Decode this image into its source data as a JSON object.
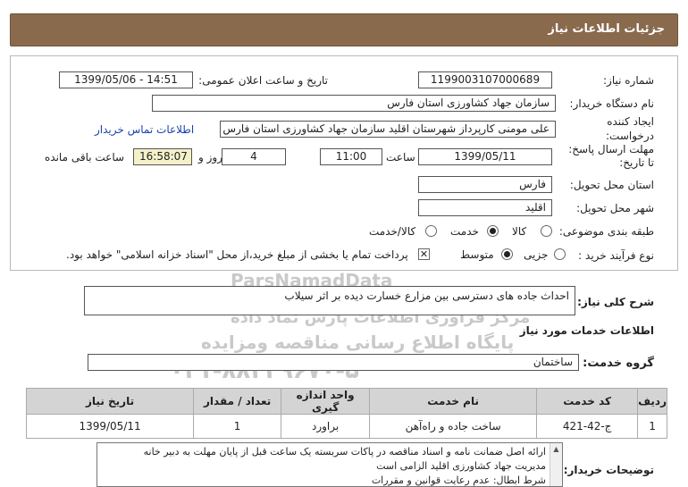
{
  "header": {
    "title": "جزئیات اطلاعات نیاز"
  },
  "form": {
    "need_number_label": "شماره نیاز:",
    "need_number": "1199003107000689",
    "announce_label": "تاریخ و ساعت اعلان عمومی:",
    "announce_value": "1399/05/06 - 14:51",
    "buyer_label": "نام دستگاه خریدار:",
    "buyer_value": "سازمان جهاد کشاورزی استان فارس",
    "creator_label_1": "ایجاد کننده",
    "creator_label_2": "درخواست:",
    "creator_value": "علی  مومنی  کارپرداز شهرستان اقلید  سازمان جهاد کشاورزی استان فارس",
    "contact_link": "اطلاعات تماس خریدار",
    "deadline_label_1": "مهلت ارسال پاسخ:",
    "deadline_label_2": "تا تاریخ:",
    "deadline_date": "1399/05/11",
    "time_label": "ساعت",
    "deadline_time": "11:00",
    "days_value": "4",
    "days_label": "روز و",
    "remaining_time": "16:58:07",
    "remaining_label": "ساعت باقی مانده",
    "province_label": "استان محل تحویل:",
    "province_value": "فارس",
    "city_label": "شهر محل تحویل:",
    "city_value": "اقلید",
    "category_label": "طبقه بندی موضوعی:",
    "category_options": [
      {
        "label": "کالا",
        "selected": false
      },
      {
        "label": "خدمت",
        "selected": true
      },
      {
        "label": "کالا/خدمت",
        "selected": false
      }
    ],
    "process_label": "نوع فرآیند خرید :",
    "process_options": [
      {
        "label": "جزیی",
        "selected": false
      },
      {
        "label": "متوسط",
        "selected": true
      }
    ],
    "payment_checked": true,
    "payment_text": "پرداخت تمام یا بخشی از مبلغ خرید،از محل \"اسناد خزانه اسلامی\" خواهد بود."
  },
  "summary": {
    "label": "شرح کلی نیاز:",
    "value": "احداث جاده های دسترسی بین مزارع خسارت دیده بر اثر سیلاب"
  },
  "services_title": "اطلاعات خدمات مورد نیاز",
  "service_group": {
    "label": "گروه خدمت:",
    "value": "ساختمان"
  },
  "table": {
    "headers": [
      "ردیف",
      "کد خدمت",
      "نام خدمت",
      "واحد اندازه گیری",
      "تعداد / مقدار",
      "تاریخ نیاز"
    ],
    "rows": [
      [
        "1",
        "ج-42-421",
        "ساخت جاده و راه‌آهن",
        "براورد",
        "1",
        "1399/05/11"
      ]
    ]
  },
  "buyer_notes": {
    "label": "توضیحات خریدار:",
    "lines": [
      "ارائه اصل ضمانت نامه و اسناد مناقصه  در پاکات سربسته یک ساعت قبل از پایان مهلت به دبیر خانه",
      "مدیریت جهاد کشاورزی اقلید الزامی است",
      "شرط ابطال: عدم رعایت قوانین و مقررات"
    ]
  },
  "watermark": {
    "brand": "ParsNamadData",
    "line1": "مرکز فراوری اطلاعات پارس نماد داده",
    "line2": "پایگاه اطلاع رسانی مناقصه ومزایده",
    "phone": "۰۲۱-۸۸۳۴۹۶۷۰-۵"
  }
}
